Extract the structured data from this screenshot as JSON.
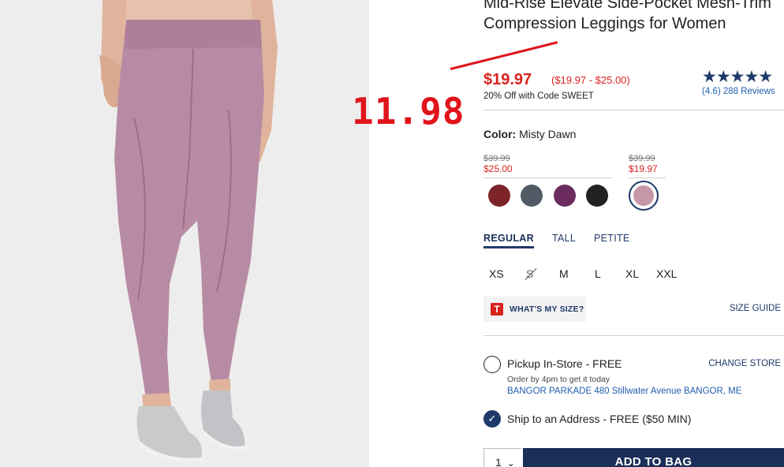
{
  "product": {
    "title": "Mid-Rise Elevate Side-Pocket Mesh-Trim Compression Leggings for Women",
    "price_sale": "$19.97",
    "price_range": "($19.97 - $25.00)",
    "promo": "20% Off with Code SWEET",
    "rating_stars": "★★★★★",
    "rating_value": 4.6,
    "reviews": "(4.6) 288 Reviews",
    "color_label": "Color:",
    "color_value": "Misty Dawn",
    "image_background": "#ececec",
    "legging_color": "#b88ba4"
  },
  "annotation": {
    "handwritten_price": "11.98",
    "color": "#e0141b"
  },
  "price_groups": [
    {
      "was": "$39.99",
      "now": "$25.00"
    },
    {
      "was": "$39.99",
      "now": "$19.97"
    }
  ],
  "swatches": [
    {
      "name": "burgundy",
      "color": "#7c2428"
    },
    {
      "name": "slate",
      "color": "#525b65"
    },
    {
      "name": "plum",
      "color": "#6c2c5f"
    },
    {
      "name": "black",
      "color": "#222222"
    },
    {
      "name": "misty-dawn",
      "color": "#c597a8",
      "selected": true
    }
  ],
  "fit_tabs": [
    "REGULAR",
    "TALL",
    "PETITE"
  ],
  "sizes": [
    "XS",
    "S",
    "M",
    "L",
    "XL",
    "XXL"
  ],
  "size_help": {
    "logo": "T",
    "label": "WHAT'S MY SIZE?",
    "guide": "SIZE GUIDE"
  },
  "pickup": {
    "label": "Pickup In-Store - FREE",
    "note": "Order by 4pm to get it today",
    "store": "BANGOR PARKADE 480 Stillwater Avenue  BANGOR, ME",
    "change": "CHANGE STORE"
  },
  "ship": {
    "label": "Ship to an Address - FREE ($50 MIN)"
  },
  "cart": {
    "qty": "1",
    "qty_chevron": "⌄",
    "add_label": "ADD TO BAG"
  },
  "colors": {
    "brand_navy": "#1a2f57",
    "sale_red": "#d8231d",
    "link_blue": "#1e5dab"
  }
}
